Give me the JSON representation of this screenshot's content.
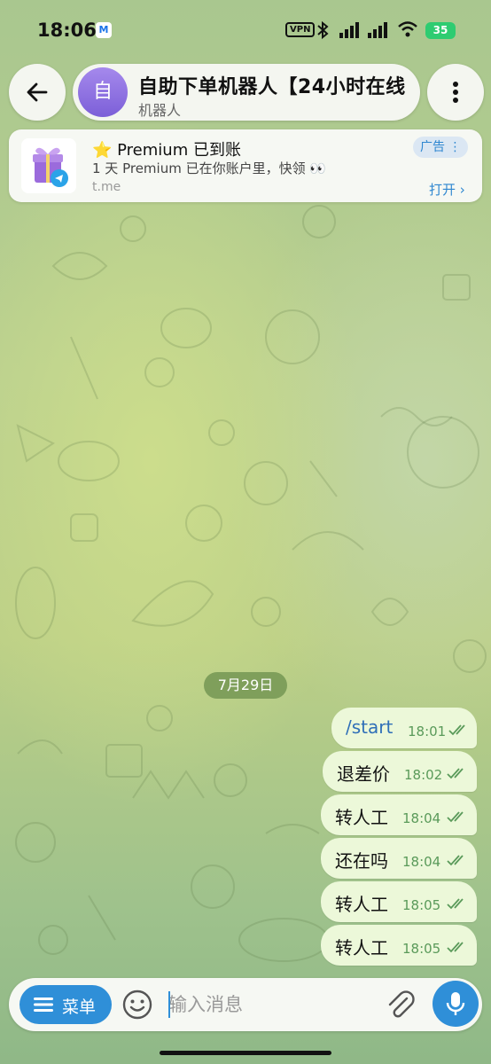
{
  "status_bar": {
    "time": "18:06",
    "mail_badge": "M",
    "vpn_label": "VPN",
    "battery": "35"
  },
  "header": {
    "back_icon": "arrow-left-icon",
    "avatar_letter": "自",
    "title": "自助下单机器人【24小时在线",
    "subtitle": "机器人",
    "more_icon": "more-vertical-icon"
  },
  "ad": {
    "thumb_icon": "gift-telegram-icon",
    "title": "⭐ Premium 已到账",
    "text": "1 天 Premium 已在你账户里，快领 👀",
    "link": "t.me",
    "tag": "广告 ⋮",
    "open_label": "打开 ›"
  },
  "date_chip": "7月29日",
  "messages": [
    {
      "text": "/start",
      "time": "18:01",
      "is_command": true
    },
    {
      "text": "退差价",
      "time": "18:02",
      "is_command": false
    },
    {
      "text": "转人工",
      "time": "18:04",
      "is_command": false
    },
    {
      "text": "还在吗",
      "time": "18:04",
      "is_command": false
    },
    {
      "text": "转人工",
      "time": "18:05",
      "is_command": false
    },
    {
      "text": "转人工",
      "time": "18:05",
      "is_command": false
    }
  ],
  "composer": {
    "menu_label": "菜单",
    "input_placeholder": "输入消息",
    "emoji_icon": "smiley-icon",
    "attach_icon": "paperclip-icon",
    "mic_icon": "microphone-icon"
  },
  "colors": {
    "accent": "#2f8fd8",
    "bubble": "#ecf8d9",
    "tick_green": "#5a9a5a"
  }
}
